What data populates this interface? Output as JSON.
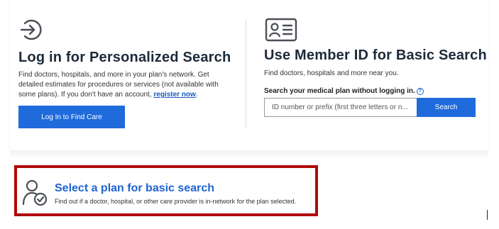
{
  "login": {
    "icon": "arrow-in-circle-icon",
    "title": "Log in for Personalized Search",
    "desc_part1": "Find doctors, hospitals, and more in your plan's network. Get detailed estimates for procedures or services (not available with some plans). If you don't have an account, ",
    "register_link": "register now",
    "desc_part2": ".",
    "button": "Log In to Find Care"
  },
  "member": {
    "icon": "id-card-icon",
    "title": "Use Member ID for Basic Search",
    "desc": "Find doctors, hospitals and more near you.",
    "search_label": "Search your medical plan without logging in.",
    "help_glyph": "?",
    "input_placeholder": "ID number or prefix (first three letters or n...",
    "search_button": "Search"
  },
  "plan": {
    "icon": "person-check-icon",
    "title": "Select a plan for basic search",
    "desc": "Find out if a doctor, hospital, or other care provider is in-network for the plan selected."
  },
  "colors": {
    "primary_button": "#1f6bdc",
    "link": "#1a5bbf",
    "highlight_border": "#b00a0a",
    "title_text": "#1d2a3a"
  }
}
